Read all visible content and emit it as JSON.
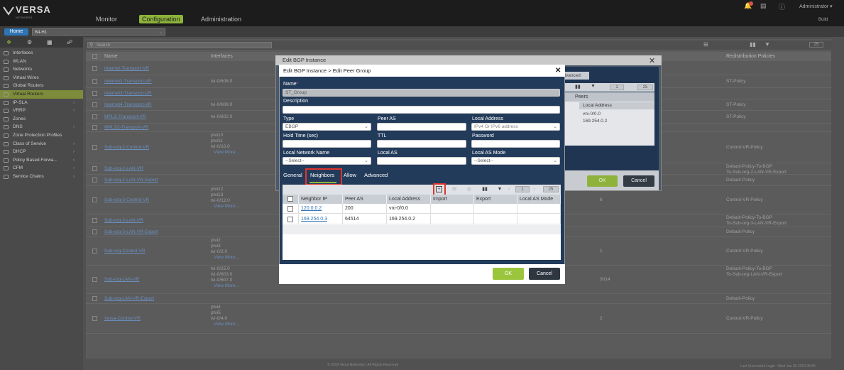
{
  "topbar": {
    "logo": "VERSA",
    "logo_sub": "NETWORKS",
    "nav": [
      "Monitor",
      "Configuration",
      "Administration"
    ],
    "user": "Administrator",
    "build_label": "Build"
  },
  "context": {
    "home_label": "Home",
    "appliance": "B4-H1"
  },
  "sidebar": {
    "items": [
      {
        "label": "Interfaces",
        "chevron": false
      },
      {
        "label": "WLAN",
        "chevron": false
      },
      {
        "label": "Networks",
        "chevron": false
      },
      {
        "label": "Virtual Wires",
        "chevron": false
      },
      {
        "label": "Global Routers",
        "chevron": false
      },
      {
        "label": "Virtual Routers",
        "chevron": false
      },
      {
        "label": "IP-SLA",
        "chevron": true
      },
      {
        "label": "VRRP",
        "chevron": true
      },
      {
        "label": "Zones",
        "chevron": false
      },
      {
        "label": "DNS",
        "chevron": true
      },
      {
        "label": "Zone Protection Profiles",
        "chevron": false
      },
      {
        "label": "Class of Service",
        "chevron": true
      },
      {
        "label": "DHCP",
        "chevron": true
      },
      {
        "label": "Policy Based Forwa...",
        "chevron": true
      },
      {
        "label": "CFM",
        "chevron": true
      },
      {
        "label": "Service Chains",
        "chevron": true
      }
    ]
  },
  "main": {
    "search_placeholder": "Search",
    "page_count": "25",
    "columns": {
      "name": "Name",
      "interfaces": "Interfaces",
      "redistribution": "Redistribution Policies"
    },
    "rows": [
      {
        "name": "Internet-Transport-VR",
        "interfaces": "",
        "extra": "",
        "redist": ""
      },
      {
        "name": "Internet2-Transport-VR",
        "interfaces": "tvi-0/606.0",
        "extra": "",
        "redist": "ST-Policy"
      },
      {
        "name": "Internet3-Transport-VR",
        "interfaces": "",
        "extra": "",
        "redist": ""
      },
      {
        "name": "Internet4-Transport-VR",
        "interfaces": "tvi-0/608.0",
        "extra": "",
        "redist": "ST-Policy"
      },
      {
        "name": "MPLS-Transport-VR",
        "interfaces": "tvi-0/602.0",
        "extra": "",
        "redist": "ST-Policy"
      },
      {
        "name": "MPLS2-Transport-VR",
        "interfaces": "",
        "extra": "",
        "redist": ""
      },
      {
        "name": "Sub-org-2-Control-VR",
        "interfaces": "ptvi10\nptvi11\ntvi-0/10.0",
        "more": "View More...",
        "extra": "",
        "redist": "Control-VR-Policy"
      },
      {
        "name": "Sub-org-2-LAN-VR",
        "interfaces": "",
        "extra": "",
        "redist": "Default-Policy-To-BGP\nTo-Sub-org-2-LAN-VR-Export"
      },
      {
        "name": "Sub-org-2-LAN-VR-Export",
        "interfaces": "",
        "extra": "",
        "redist": "Default-Policy"
      },
      {
        "name": "Sub-org-3-Control-VR",
        "interfaces": "ptvi12\nptvi13\ntvi-0/12.0",
        "more": "View More...",
        "extra": "6",
        "redist": "Control-VR-Policy"
      },
      {
        "name": "Sub-org-3-LAN-VR",
        "interfaces": "",
        "extra": "",
        "redist": "Default-Policy-To-BGP\nTo-Sub-org-3-LAN-VR-Export"
      },
      {
        "name": "Sub-org-3-LAN-VR-Export",
        "interfaces": "",
        "extra": "",
        "redist": "Default-Policy"
      },
      {
        "name": "Sub-org-Control-VR",
        "interfaces": "ptvi2\nptvi3\ntvi-0/2.0",
        "more": "View More...",
        "extra": "1",
        "redist": "Control-VR-Policy"
      },
      {
        "name": "Sub-org-LAN-VR",
        "interfaces": "tvi-0/15.0\ntvi-0/603.0\ntvi-0/607.0",
        "more": "View More...",
        "extra": "3014",
        "redist": "Default-Policy-To-BGP\nTo-Sub-org-LAN-VR-Export"
      },
      {
        "name": "Sub-org-LAN-VR-Export",
        "interfaces": "",
        "extra": "",
        "redist": "Default-Policy"
      },
      {
        "name": "Versa-Control-VR",
        "interfaces": "ptvi4\nptvi5\ntvi-0/4.0",
        "more": "View More...",
        "extra": "2",
        "redist": "Control-VR-Policy"
      }
    ],
    "footer_copyright": "© 2019 Versa Networks | All Rights Reserved",
    "footer_login": "Last Successful Login : Wed Jan 30 2019 06:55"
  },
  "outer_dialog": {
    "title": "Edit BGP Instance",
    "tab_partial": "Advanced",
    "peers_label": "Peers",
    "col_local_address": "Local Address",
    "cells": [
      "vni-0/0.0",
      "169.254.0.2"
    ],
    "pager": "1",
    "page_size": "25",
    "ok": "OK",
    "cancel": "Cancel"
  },
  "dialog": {
    "title": "Edit BGP Instance > Edit Peer Group",
    "name_label": "Name",
    "name_value": "ST_Group",
    "description_label": "Description",
    "type_label": "Type",
    "type_value": "EBGP",
    "peer_as_label": "Peer AS",
    "local_address_label": "Local Address",
    "local_address_placeholder": "IPv4 Or IPv6 address",
    "hold_time_label": "Hold Time (sec)",
    "ttl_label": "TTL",
    "password_label": "Password",
    "local_network_label": "Local Network Name",
    "local_network_value": "--Select--",
    "local_as_label": "Local AS",
    "local_as_mode_label": "Local AS Mode",
    "local_as_mode_value": "--Select--",
    "tabs": [
      "General",
      "Neighbors",
      "Allow",
      "Advanced"
    ],
    "active_tab": "Neighbors",
    "pager": "1",
    "page_size": "25",
    "table": {
      "columns": [
        "Neighbor IP",
        "Peer AS",
        "Local Address",
        "Import",
        "Export",
        "Local AS Mode"
      ],
      "rows": [
        {
          "ip": "120.0.0.2",
          "peer_as": "200",
          "local": "vni-0/0.0",
          "import": "",
          "export": "",
          "mode": ""
        },
        {
          "ip": "169.254.0.3",
          "peer_as": "64514",
          "local": "169.254.0.2",
          "import": "",
          "export": "",
          "mode": ""
        }
      ]
    },
    "ok": "OK",
    "cancel": "Cancel"
  },
  "colors": {
    "accent_green": "#8fb23d",
    "highlight_red": "#e0342c",
    "dialog_navy": "#233b5a",
    "link_blue": "#2f75b5"
  }
}
